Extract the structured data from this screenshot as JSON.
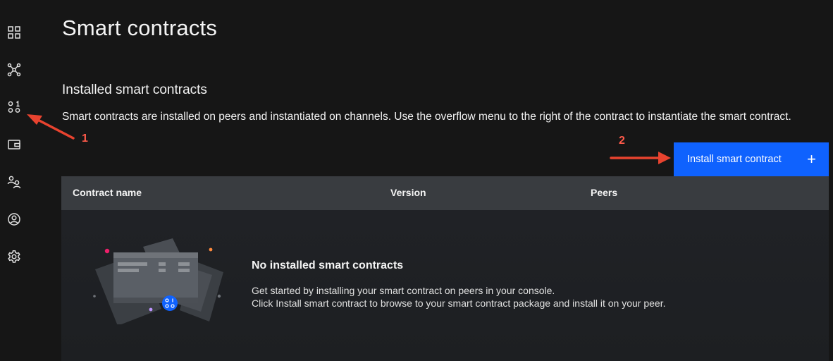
{
  "sidebar": {
    "items": [
      {
        "icon": "dashboard-grid-icon"
      },
      {
        "icon": "network-nodes-icon"
      },
      {
        "icon": "smart-contracts-icon"
      },
      {
        "icon": "wallet-icon"
      },
      {
        "icon": "users-icon"
      },
      {
        "icon": "user-profile-icon"
      },
      {
        "icon": "settings-gear-icon"
      }
    ]
  },
  "header": {
    "title": "Smart contracts"
  },
  "section": {
    "title": "Installed smart contracts",
    "description": "Smart contracts are installed on peers and instantiated on channels. Use the overflow menu to the right of the contract to instantiate the smart contract."
  },
  "install_button": {
    "label": "Install smart contract",
    "icon": "plus-icon"
  },
  "table": {
    "columns": [
      "Contract name",
      "Version",
      "Peers"
    ],
    "empty_state": {
      "title": "No installed smart contracts",
      "lines": [
        "Get started by installing your smart contract on peers in your console.",
        "Click Install smart contract to browse to your smart contract package and install it on your peer."
      ]
    }
  },
  "annotations": {
    "step1": "1",
    "step2": "2"
  },
  "colors": {
    "background": "#161616",
    "primary_button": "#0f62fe",
    "table_header": "#393c40",
    "annotation_arrow": "#e8432f"
  }
}
